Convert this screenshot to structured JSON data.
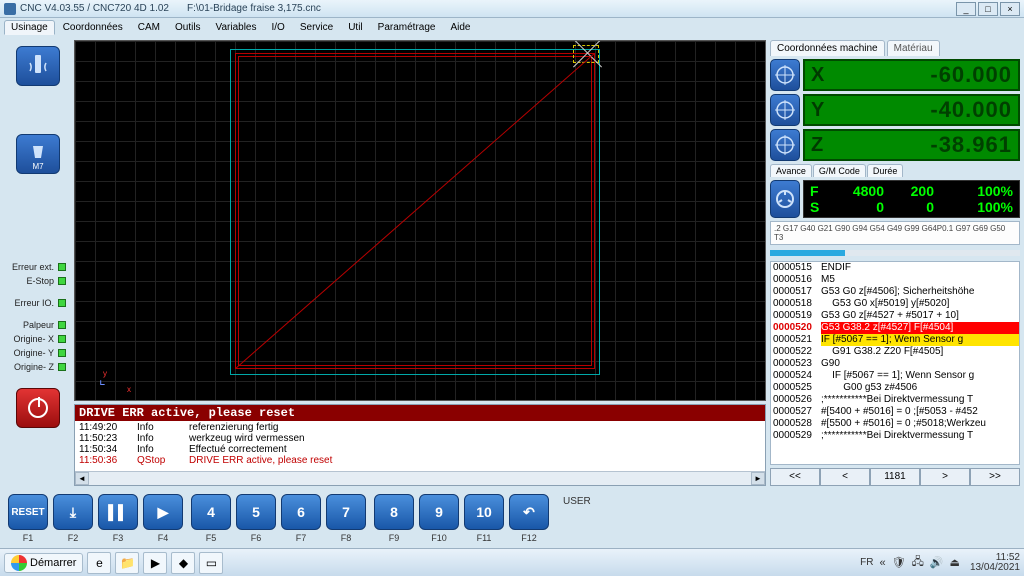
{
  "title": {
    "app": "CNC V4.03.55 / CNC720 4D 1.02",
    "file": "F:\\01-Bridage fraise 3,175.cnc"
  },
  "win_buttons": {
    "min": "_",
    "max": "□",
    "close": "×"
  },
  "menu": {
    "items": [
      "Usinage",
      "Coordonnées",
      "CAM",
      "Outils",
      "Variables",
      "I/O",
      "Service",
      "Util",
      "Paramétrage",
      "Aide"
    ],
    "active": 0
  },
  "sidebar": {
    "m7": "M7",
    "status": [
      {
        "label": "Erreur ext."
      },
      {
        "label": "E-Stop"
      },
      {
        "label": "Erreur IO."
      },
      {
        "label": "Palpeur"
      },
      {
        "label": "Origine- X"
      },
      {
        "label": "Origine- Y"
      },
      {
        "label": "Origine- Z"
      }
    ]
  },
  "log": {
    "banner": "DRIVE ERR active, please reset",
    "rows": [
      {
        "t": "11:49:20",
        "ty": "Info",
        "msg": "referenzierung fertig"
      },
      {
        "t": "11:50:23",
        "ty": "Info",
        "msg": "werkzeug wird vermessen"
      },
      {
        "t": "11:50:34",
        "ty": "Info",
        "msg": "Effectué correctement"
      },
      {
        "t": "11:50:36",
        "ty": "QStop",
        "msg": "DRIVE ERR active, please reset",
        "err": true
      }
    ]
  },
  "right_tabs": {
    "a": "Coordonnées machine",
    "b": "Matériau"
  },
  "dro": {
    "x": {
      "axis": "X",
      "val": "-60.000"
    },
    "y": {
      "axis": "Y",
      "val": "-40.000"
    },
    "z": {
      "axis": "Z",
      "val": "-38.961"
    }
  },
  "feed_tabs": [
    "Avance",
    "G/M Code",
    "Durée"
  ],
  "feed": {
    "r1": {
      "a": "F",
      "b": "4800",
      "c": "200",
      "d": "100%"
    },
    "r2": {
      "a": "S",
      "b": "0",
      "c": "0",
      "d": "100%"
    }
  },
  "modal_line": ".2 G17 G40 G21 G90 G94 G54 G49 G99 G64P0.1 G97 G69 G50 T3",
  "gcode": [
    {
      "ln": "0000515",
      "txt": "ENDIF"
    },
    {
      "ln": "0000516",
      "txt": "M5"
    },
    {
      "ln": "0000517",
      "txt": "G53 G0 z[#4506]; Sicherheitshöhe"
    },
    {
      "ln": "0000518",
      "txt": "    G53 G0 x[#5019] y[#5020]"
    },
    {
      "ln": "0000519",
      "txt": "G53 G0 z[#4527 + #5017 + 10]"
    },
    {
      "ln": "0000520",
      "txt": "G53 G38.2 z[#4527] F[#4504]",
      "hl": "red"
    },
    {
      "ln": "0000521",
      "txt": "IF [#5067 == 1]; Wenn Sensor g",
      "hl": "yel"
    },
    {
      "ln": "0000522",
      "txt": "    G91 G38.2 Z20 F[#4505]"
    },
    {
      "ln": "0000523",
      "txt": "G90"
    },
    {
      "ln": "0000524",
      "txt": "    IF [#5067 == 1]; Wenn Sensor g"
    },
    {
      "ln": "0000525",
      "txt": "        G00 g53 z#4506"
    },
    {
      "ln": "0000526",
      "txt": ";***********Bei Direktvermessung T"
    },
    {
      "ln": "0000527",
      "txt": "#[5400 + #5016] = 0 ;[#5053 - #452"
    },
    {
      "ln": "0000528",
      "txt": "#[5500 + #5016] = 0 ;#5018;Werkzeu"
    },
    {
      "ln": "0000529",
      "txt": ";***********Bei Direktvermessung T"
    }
  ],
  "nav": {
    "first": "<<",
    "prev": "<",
    "pos": "1181",
    "next": ">",
    "last": ">>"
  },
  "fkeys": {
    "groups": [
      [
        {
          "label": "RESET",
          "cap": "F1"
        },
        {
          "label": "⤓",
          "cap": "F2"
        },
        {
          "label": "▌▌",
          "cap": "F3"
        },
        {
          "label": "▶",
          "cap": "F4"
        }
      ],
      [
        {
          "label": "4",
          "cap": "F5"
        },
        {
          "label": "5",
          "cap": "F6"
        },
        {
          "label": "6",
          "cap": "F7"
        },
        {
          "label": "7",
          "cap": "F8"
        }
      ],
      [
        {
          "label": "8",
          "cap": "F9"
        },
        {
          "label": "9",
          "cap": "F10"
        },
        {
          "label": "10",
          "cap": "F11"
        },
        {
          "label": "↶",
          "cap": "F12"
        }
      ]
    ],
    "user": "USER"
  },
  "taskbar": {
    "start": "Démarrer",
    "lang": "FR",
    "time": "11:52",
    "date": "13/04/2021"
  }
}
